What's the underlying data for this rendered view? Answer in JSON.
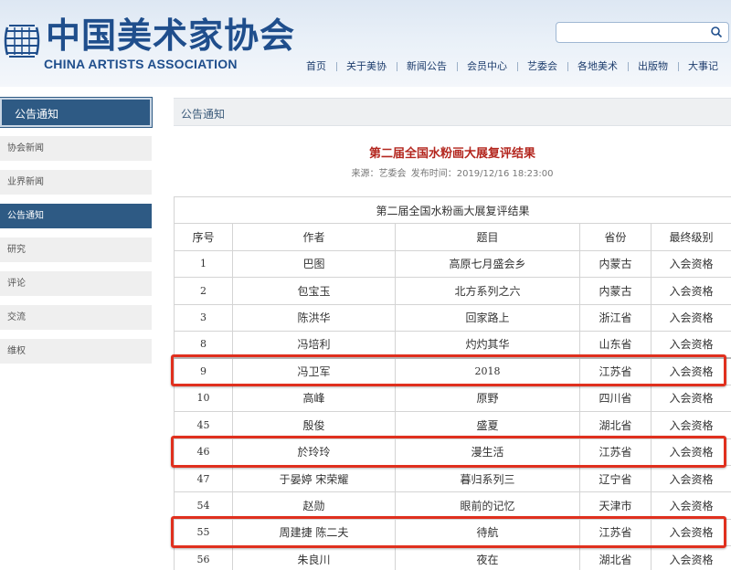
{
  "header": {
    "logo_cn": "中国美术家协会",
    "logo_en": "CHINA ARTISTS ASSOCIATION",
    "search_placeholder": "",
    "nav": [
      "首页",
      "关于美协",
      "新闻公告",
      "会员中心",
      "艺委会",
      "各地美术",
      "出版物",
      "大事记"
    ]
  },
  "sidebar": {
    "title": "公告通知",
    "items": [
      "协会新闻",
      "业界新闻",
      "公告通知",
      "研究",
      "评论",
      "交流",
      "维权"
    ],
    "active_index": 2
  },
  "main": {
    "section_title": "公告通知",
    "article_title": "第二届全国水粉画大展复评结果",
    "source": "来源：艺委会",
    "publish_time": "发布时间：2019/12/16 18:23:00"
  },
  "table": {
    "caption": "第二届全国水粉画大展复评结果",
    "headers": [
      "序号",
      "作者",
      "题目",
      "省份",
      "最终级别"
    ],
    "rows": [
      [
        "1",
        "巴图",
        "高原七月盛会乡",
        "内蒙古",
        "入会资格"
      ],
      [
        "2",
        "包宝玉",
        "北方系列之六",
        "内蒙古",
        "入会资格"
      ],
      [
        "3",
        "陈洪华",
        "回家路上",
        "浙江省",
        "入会资格"
      ],
      [
        "8",
        "冯培利",
        "灼灼其华",
        "山东省",
        "入会资格"
      ],
      [
        "9",
        "冯卫军",
        "2018",
        "江苏省",
        "入会资格"
      ],
      [
        "10",
        "高峰",
        "原野",
        "四川省",
        "入会资格"
      ],
      [
        "45",
        "殷俊",
        "盛夏",
        "湖北省",
        "入会资格"
      ],
      [
        "46",
        "於玲玲",
        "漫生活",
        "江苏省",
        "入会资格"
      ],
      [
        "47",
        "于晏婷  宋荣耀",
        "暮归系列三",
        "辽宁省",
        "入会资格"
      ],
      [
        "54",
        "赵勋",
        "眼前的记忆",
        "天津市",
        "入会资格"
      ],
      [
        "55",
        "周建捷  陈二夫",
        "待航",
        "江苏省",
        "入会资格"
      ],
      [
        "56",
        "朱良川",
        "夜在",
        "湖北省",
        "入会资格"
      ]
    ],
    "highlighted_rows": [
      4,
      7,
      10
    ]
  },
  "colors": {
    "brand_blue": "#1f4e8c",
    "sidebar_active": "#2e5a84",
    "title_red": "#b3261e",
    "highlight_red": "#e0301e"
  }
}
